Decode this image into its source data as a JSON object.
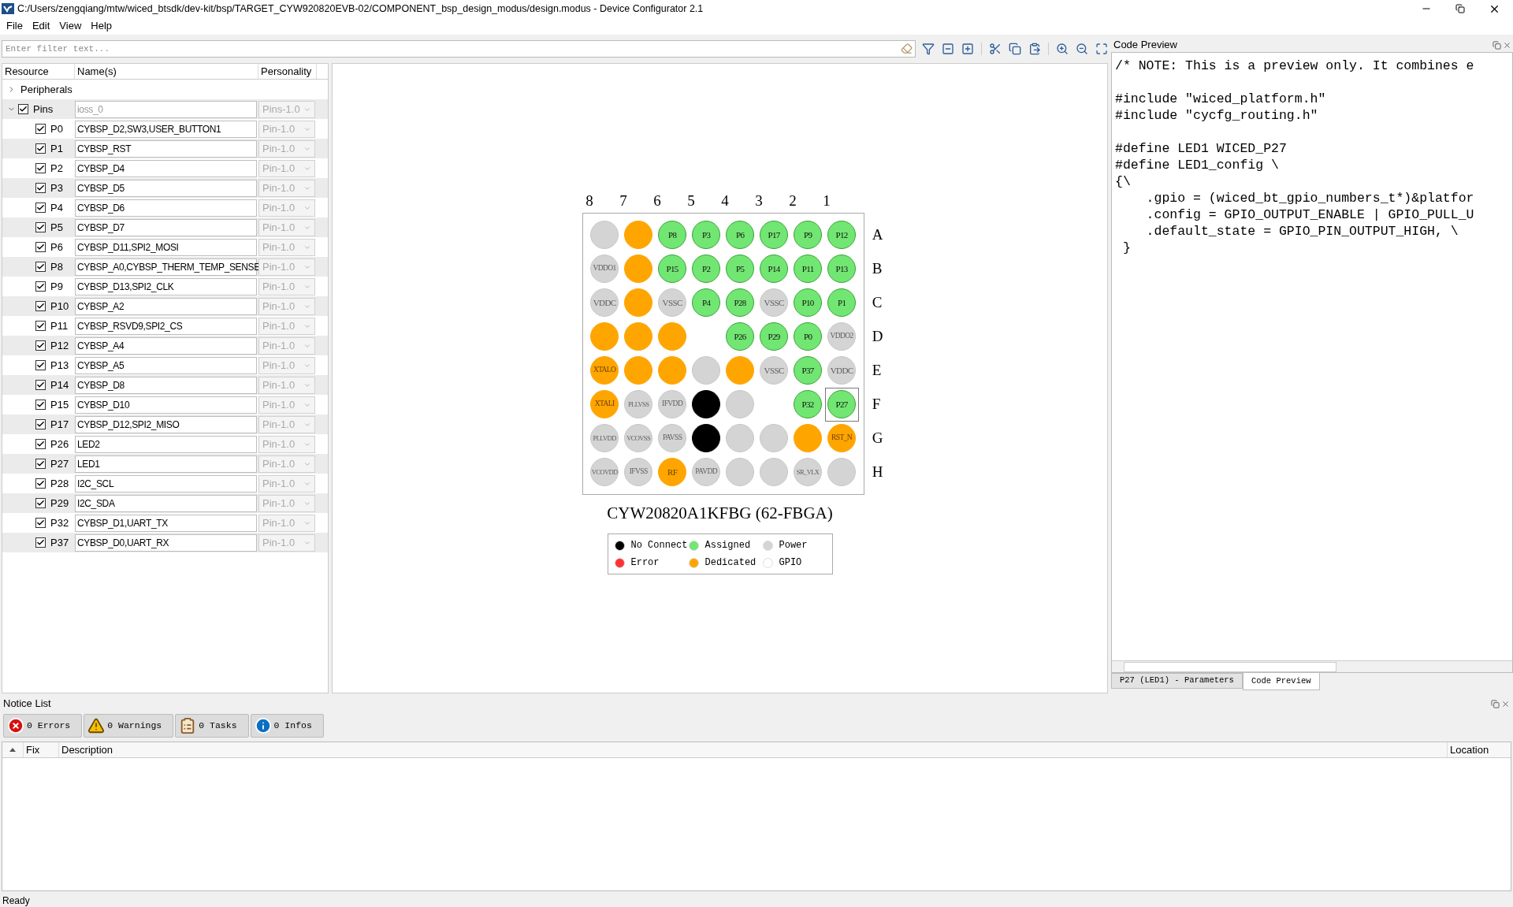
{
  "window": {
    "title": "C:/Users/zengqiang/mtw/wiced_btsdk/dev-kit/bsp/TARGET_CYW920820EVB-02/COMPONENT_bsp_design_modus/design.modus - Device Configurator 2.1"
  },
  "menu": [
    {
      "label": "File"
    },
    {
      "label": "Edit"
    },
    {
      "label": "View"
    },
    {
      "label": "Help"
    }
  ],
  "filter": {
    "placeholder": "Enter filter text..."
  },
  "resource_table": {
    "columns": [
      "Resource",
      "Name(s)",
      "Personality"
    ],
    "rows": [
      {
        "resource": "Peripherals",
        "expanded": false
      },
      {
        "resource": "Pins",
        "expanded": true,
        "checked": true,
        "names": "ioss_0",
        "personality": "Pins-1.0",
        "children": [
          {
            "resource": "P0",
            "checked": true,
            "names": "CYBSP_D2,SW3,USER_BUTTON1",
            "personality": "Pin-1.0"
          },
          {
            "resource": "P1",
            "checked": true,
            "names": "CYBSP_RST",
            "personality": "Pin-1.0"
          },
          {
            "resource": "P2",
            "checked": true,
            "names": "CYBSP_D4",
            "personality": "Pin-1.0"
          },
          {
            "resource": "P3",
            "checked": true,
            "names": "CYBSP_D5",
            "personality": "Pin-1.0"
          },
          {
            "resource": "P4",
            "checked": true,
            "names": "CYBSP_D6",
            "personality": "Pin-1.0"
          },
          {
            "resource": "P5",
            "checked": true,
            "names": "CYBSP_D7",
            "personality": "Pin-1.0"
          },
          {
            "resource": "P6",
            "checked": true,
            "names": "CYBSP_D11,SPI2_MOSI",
            "personality": "Pin-1.0"
          },
          {
            "resource": "P8",
            "checked": true,
            "names": "CYBSP_A0,CYBSP_THERM_TEMP_SENSE",
            "personality": "Pin-1.0"
          },
          {
            "resource": "P9",
            "checked": true,
            "names": "CYBSP_D13,SPI2_CLK",
            "personality": "Pin-1.0"
          },
          {
            "resource": "P10",
            "checked": true,
            "names": "CYBSP_A2",
            "personality": "Pin-1.0"
          },
          {
            "resource": "P11",
            "checked": true,
            "names": "CYBSP_RSVD9,SPI2_CS",
            "personality": "Pin-1.0"
          },
          {
            "resource": "P12",
            "checked": true,
            "names": "CYBSP_A4",
            "personality": "Pin-1.0"
          },
          {
            "resource": "P13",
            "checked": true,
            "names": "CYBSP_A5",
            "personality": "Pin-1.0"
          },
          {
            "resource": "P14",
            "checked": true,
            "names": "CYBSP_D8",
            "personality": "Pin-1.0"
          },
          {
            "resource": "P15",
            "checked": true,
            "names": "CYBSP_D10",
            "personality": "Pin-1.0"
          },
          {
            "resource": "P17",
            "checked": true,
            "names": "CYBSP_D12,SPI2_MISO",
            "personality": "Pin-1.0"
          },
          {
            "resource": "P26",
            "checked": true,
            "names": "LED2",
            "personality": "Pin-1.0"
          },
          {
            "resource": "P27",
            "checked": true,
            "names": "LED1",
            "personality": "Pin-1.0"
          },
          {
            "resource": "P28",
            "checked": true,
            "names": "I2C_SCL",
            "personality": "Pin-1.0"
          },
          {
            "resource": "P29",
            "checked": true,
            "names": "I2C_SDA",
            "personality": "Pin-1.0"
          },
          {
            "resource": "P32",
            "checked": true,
            "names": "CYBSP_D1,UART_TX",
            "personality": "Pin-1.0"
          },
          {
            "resource": "P37",
            "checked": true,
            "names": "CYBSP_D0,UART_RX",
            "personality": "Pin-1.0"
          }
        ]
      }
    ]
  },
  "device_view": {
    "column_labels": [
      "8",
      "7",
      "6",
      "5",
      "4",
      "3",
      "2",
      "1"
    ],
    "rows": [
      {
        "label": "A",
        "pins": [
          {
            "kind": "power",
            "selected": false
          },
          {
            "kind": "dedicated",
            "selected": false
          },
          {
            "label": "P8",
            "kind": "assigned",
            "selected": false
          },
          {
            "label": "P3",
            "kind": "assigned",
            "selected": false
          },
          {
            "label": "P6",
            "kind": "assigned",
            "selected": false
          },
          {
            "label": "P17",
            "kind": "assigned",
            "selected": false
          },
          {
            "label": "P9",
            "kind": "assigned",
            "selected": false
          },
          {
            "label": "P12",
            "kind": "assigned",
            "selected": false
          }
        ]
      },
      {
        "label": "B",
        "pins": [
          {
            "label": "VDDO1",
            "kind": "power",
            "selected": false
          },
          {
            "kind": "dedicated",
            "selected": false
          },
          {
            "label": "P15",
            "kind": "assigned",
            "selected": false
          },
          {
            "label": "P2",
            "kind": "assigned",
            "selected": false
          },
          {
            "label": "P5",
            "kind": "assigned",
            "selected": false
          },
          {
            "label": "P14",
            "kind": "assigned",
            "selected": false
          },
          {
            "label": "P11",
            "kind": "assigned",
            "selected": false
          },
          {
            "label": "P13",
            "kind": "assigned",
            "selected": false
          }
        ]
      },
      {
        "label": "C",
        "pins": [
          {
            "label": "VDDC",
            "kind": "power",
            "selected": false
          },
          {
            "kind": "dedicated",
            "selected": false
          },
          {
            "label": "VSSC",
            "kind": "power",
            "selected": false
          },
          {
            "label": "P4",
            "kind": "assigned",
            "selected": false
          },
          {
            "label": "P28",
            "kind": "assigned",
            "selected": false
          },
          {
            "label": "VSSC",
            "kind": "power",
            "selected": false
          },
          {
            "label": "P10",
            "kind": "assigned",
            "selected": false
          },
          {
            "label": "P1",
            "kind": "assigned",
            "selected": false
          }
        ]
      },
      {
        "label": "D",
        "pins": [
          {
            "kind": "dedicated",
            "selected": false
          },
          {
            "kind": "dedicated",
            "selected": false
          },
          {
            "kind": "dedicated",
            "selected": false
          },
          {
            "kind": "empty",
            "selected": false
          },
          {
            "label": "P26",
            "kind": "assigned",
            "selected": false
          },
          {
            "label": "P29",
            "kind": "assigned",
            "selected": false
          },
          {
            "label": "P0",
            "kind": "assigned",
            "selected": false
          },
          {
            "label": "VDDO2",
            "kind": "power",
            "selected": false
          }
        ]
      },
      {
        "label": "E",
        "pins": [
          {
            "label": "XTALO",
            "kind": "dedicated",
            "selected": false
          },
          {
            "kind": "dedicated",
            "selected": false
          },
          {
            "kind": "dedicated",
            "selected": false
          },
          {
            "kind": "power",
            "selected": false
          },
          {
            "kind": "dedicated",
            "selected": false
          },
          {
            "label": "VSSC",
            "kind": "power",
            "selected": false
          },
          {
            "label": "P37",
            "kind": "assigned",
            "selected": false
          },
          {
            "label": "VDDC",
            "kind": "power",
            "selected": false
          }
        ]
      },
      {
        "label": "F",
        "pins": [
          {
            "label": "XTALI",
            "kind": "dedicated",
            "selected": false
          },
          {
            "label": "PLLVSS",
            "kind": "power",
            "selected": false
          },
          {
            "label": "IFVDD",
            "kind": "power",
            "selected": false
          },
          {
            "kind": "no_connect",
            "selected": false
          },
          {
            "kind": "power",
            "selected": false
          },
          {
            "kind": "empty",
            "selected": false
          },
          {
            "label": "P32",
            "kind": "assigned",
            "selected": false
          },
          {
            "label": "P27",
            "kind": "assigned",
            "selected": true
          }
        ]
      },
      {
        "label": "G",
        "pins": [
          {
            "label": "PLLVDD",
            "kind": "power",
            "selected": false
          },
          {
            "label": "VCOVSS",
            "kind": "power",
            "selected": false
          },
          {
            "label": "PAVSS",
            "kind": "power",
            "selected": false
          },
          {
            "kind": "no_connect",
            "selected": false
          },
          {
            "kind": "power",
            "selected": false
          },
          {
            "kind": "power",
            "selected": false
          },
          {
            "kind": "dedicated",
            "selected": false
          },
          {
            "label": "RST_N",
            "kind": "dedicated",
            "selected": false
          }
        ]
      },
      {
        "label": "H",
        "pins": [
          {
            "label": "VCOVDD",
            "kind": "power",
            "selected": false
          },
          {
            "label": "IFVSS",
            "kind": "power",
            "selected": false
          },
          {
            "label": "RF",
            "kind": "dedicated",
            "selected": false
          },
          {
            "label": "PAVDD",
            "kind": "power",
            "selected": false
          },
          {
            "kind": "power",
            "selected": false
          },
          {
            "kind": "power",
            "selected": false
          },
          {
            "label": "SR_VLX",
            "kind": "power",
            "selected": false
          },
          {
            "kind": "power",
            "selected": false
          }
        ]
      }
    ],
    "package": "CYW20820A1KFBG (62-FBGA)",
    "legend": [
      {
        "label": "No Connect",
        "color": "#000000"
      },
      {
        "label": "Assigned",
        "color": "#72e672"
      },
      {
        "label": "Power",
        "color": "#d4d4d4"
      },
      {
        "label": "Error",
        "color": "#ff3333"
      },
      {
        "label": "Dedicated",
        "color": "#ffa500"
      },
      {
        "label": "GPIO",
        "color": "#ffffff"
      }
    ]
  },
  "code_preview": {
    "title": "Code Preview",
    "blocks": [
      {
        "lines": [
          "/* NOTE: This is a preview only. It combines e"
        ]
      },
      {
        "lines": [
          "#include \"wiced_platform.h\"",
          "#include \"cycfg_routing.h\""
        ]
      },
      {
        "lines": [
          "#define LED1 WICED_P27",
          "#define LED1_config \\",
          "{\\",
          "    .gpio = (wiced_bt_gpio_numbers_t*)&platfor",
          "    .config = GPIO_OUTPUT_ENABLE | GPIO_PULL_U",
          "    .default_state = GPIO_PIN_OUTPUT_HIGH, \\",
          " }"
        ]
      }
    ],
    "tabs": [
      {
        "label": "P27 (LED1) - Parameters",
        "selected": false
      },
      {
        "label": "Code Preview",
        "selected": true
      }
    ]
  },
  "notice_list": {
    "title": "Notice List",
    "filters": [
      {
        "label": "0 Errors",
        "kind": "error"
      },
      {
        "label": "0 Warnings",
        "kind": "warning"
      },
      {
        "label": "0 Tasks",
        "kind": "task"
      },
      {
        "label": "0 Infos",
        "kind": "info"
      }
    ],
    "columns": [
      "Fix",
      "Description",
      "Location"
    ]
  },
  "status_bar": "Ready"
}
